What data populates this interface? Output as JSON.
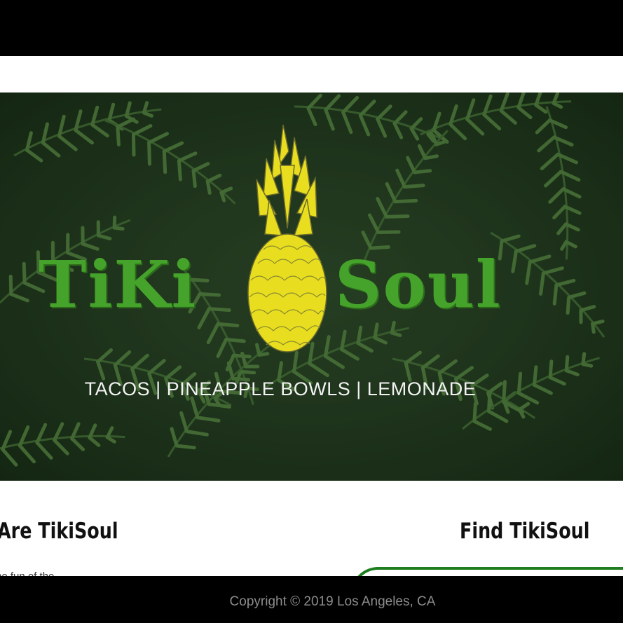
{
  "hero": {
    "logo_left": "TiKi",
    "logo_right": "Soul",
    "tagline": "TACOS | PINEAPPLE BOWLS | LEMONADE"
  },
  "sections": {
    "about_title": "Are TikiSoul",
    "about_text": "he fun of the ...",
    "find_title": "Find TikiSoul"
  },
  "footer": {
    "copyright": "Copyright © 2019 Los Angeles, CA"
  },
  "colors": {
    "logo_green": "#45a32b",
    "pineapple_yellow": "#e8de1f",
    "map_border": "#1e7d1e"
  }
}
